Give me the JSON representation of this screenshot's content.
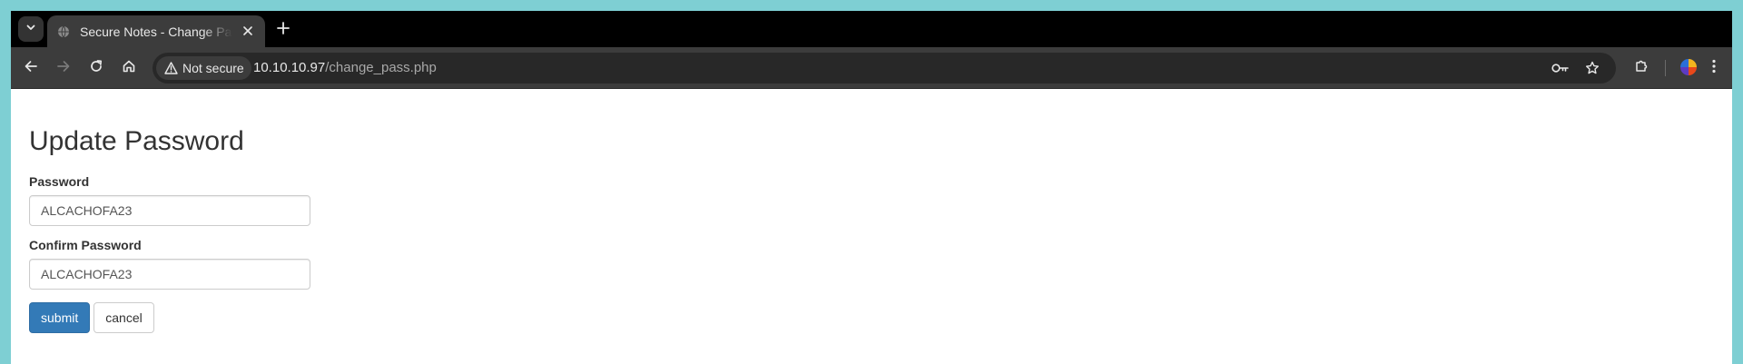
{
  "browser": {
    "tab": {
      "title": "Secure Notes - Change Password"
    },
    "address_bar": {
      "security_label": "Not secure",
      "host": "10.10.10.97",
      "path": "/change_pass.php"
    }
  },
  "page": {
    "title": "Update Password",
    "password": {
      "label": "Password",
      "value": "ALCACHOFA23"
    },
    "confirm_password": {
      "label": "Confirm Password",
      "value": "ALCACHOFA23"
    },
    "buttons": {
      "submit": "submit",
      "cancel": "cancel"
    }
  },
  "colors": {
    "primary_button": "#337ab7",
    "background_frame": "#7ecfd3"
  }
}
